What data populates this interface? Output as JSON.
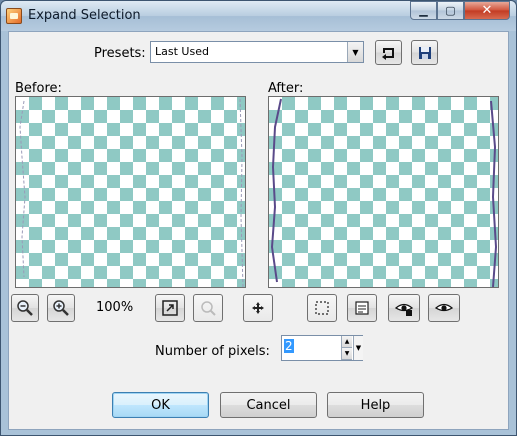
{
  "window": {
    "title": "Expand Selection",
    "controls": {
      "minimize": "▁",
      "maximize": "▢",
      "close": "✕"
    }
  },
  "presets": {
    "label": "Presets:",
    "value": "Last Used",
    "load_icon": "reset-arrow-icon",
    "save_icon": "floppy-save-icon"
  },
  "preview": {
    "before_label": "Before:",
    "after_label": "After:",
    "checker_color": "#8fc9c4",
    "selection_outline_color": "#5a4a8a"
  },
  "toolbar": {
    "zoom_out_icon": "zoom-out-icon",
    "zoom_in_icon": "zoom-in-icon",
    "zoom_level": "100%",
    "fit_icon": "fit-window-icon",
    "zoom_actual_icon": "zoom-actual-icon",
    "pan_icon": "pan-move-icon",
    "marquee_icon": "selection-marquee-icon",
    "proof_icon": "proof-window-icon",
    "auto_proof_icon": "auto-proof-eye-icon",
    "proof_eye_icon": "proof-eye-icon"
  },
  "pixels": {
    "label": "Number of pixels:",
    "value": "2"
  },
  "buttons": {
    "ok": "OK",
    "cancel": "Cancel",
    "help": "Help"
  }
}
